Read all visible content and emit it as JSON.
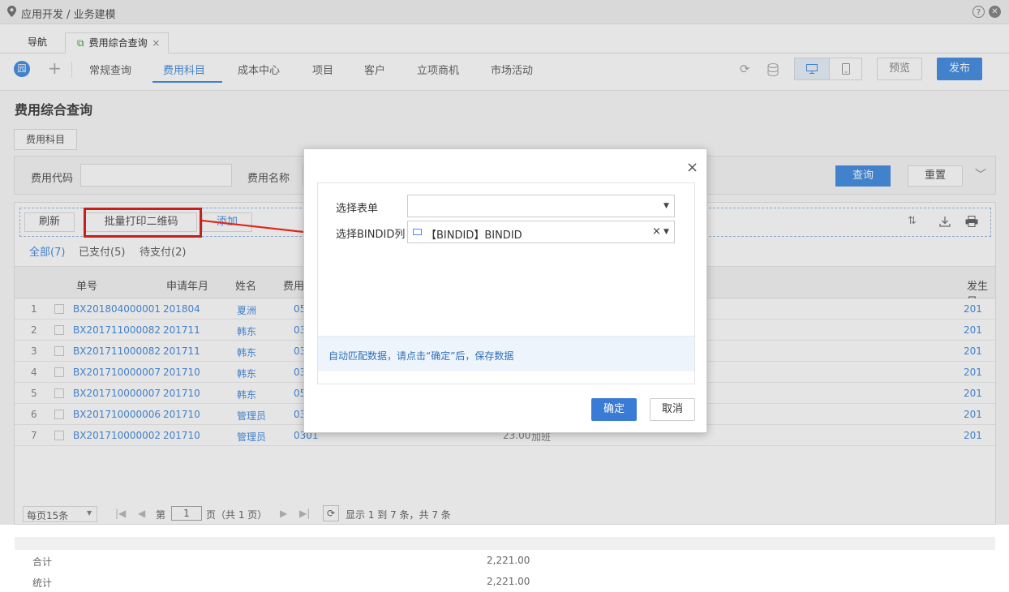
{
  "breadcrumb": "应用开发 / 业务建模",
  "window_tabs": {
    "nav": "导航",
    "active": "费用综合查询",
    "close": "×"
  },
  "menu_tabs": [
    "常规查询",
    "费用科目",
    "成本中心",
    "项目",
    "客户",
    "立项商机",
    "市场活动"
  ],
  "menu_active": "费用科目",
  "toolbar": {
    "avatar": "园",
    "add": "+",
    "preview": "预览",
    "publish": "发布"
  },
  "page_title": "费用综合查询",
  "sub_tab": "费用科目",
  "filter": {
    "code_label": "费用代码",
    "name_label": "费用名称",
    "query": "查询",
    "reset": "重置"
  },
  "actions": {
    "refresh": "刷新",
    "batch_print": "批量打印二维码",
    "add": "添加"
  },
  "status_tabs": [
    "全部(7)",
    "已支付(5)",
    "待支付(2)"
  ],
  "columns": [
    "单号",
    "申请年月",
    "姓名",
    "费用",
    "发生日"
  ],
  "rows": [
    {
      "n": "1",
      "no": "BX201804000001",
      "ym": "201804",
      "name": "夏洲",
      "fee": "05",
      "date": "201"
    },
    {
      "n": "2",
      "no": "BX201711000082",
      "ym": "201711",
      "name": "韩东",
      "fee": "03",
      "date": "201"
    },
    {
      "n": "3",
      "no": "BX201711000082",
      "ym": "201711",
      "name": "韩东",
      "fee": "03",
      "date": "201"
    },
    {
      "n": "4",
      "no": "BX201710000007",
      "ym": "201710",
      "name": "韩东",
      "fee": "03",
      "date": "201"
    },
    {
      "n": "5",
      "no": "BX201710000007",
      "ym": "201710",
      "name": "韩东",
      "fee": "05",
      "date": "201"
    },
    {
      "n": "6",
      "no": "BX201710000006",
      "ym": "201710",
      "name": "管理员",
      "fee": "03",
      "date": "201"
    },
    {
      "n": "7",
      "no": "BX201710000002",
      "ym": "201710",
      "name": "管理员",
      "fee": "0301",
      "date": "201",
      "amount": "23.00",
      "note": "加班"
    }
  ],
  "totals": {
    "sum_label": "合计",
    "sum": "2,221.00",
    "stat_label": "统计",
    "stat": "2,221.00"
  },
  "pager": {
    "per_page": "每页15条",
    "page_prefix": "第",
    "page_value": "1",
    "page_suffix": "页（共 1 页）",
    "info": "显示 1 到 7 条，共 7 条"
  },
  "dialog": {
    "close": "×",
    "select_form_label": "选择表单",
    "select_form_value": "",
    "bindid_label": "选择BINDID列",
    "bindid_value": "【BINDID】BINDID",
    "clear": "×",
    "hint": "自动匹配数据，请点击“确定”后，保存数据",
    "ok": "确定",
    "cancel": "取消"
  },
  "colors": {
    "accent": "#4a90e2",
    "annotation_red": "#d9261c",
    "ok_button": "#3a7bd5"
  }
}
